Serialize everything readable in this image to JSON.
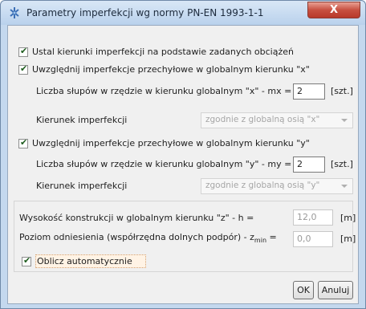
{
  "window": {
    "title": "Parametry imperfekcji wg normy PN-EN 1993-1-1",
    "close_glyph": "X",
    "icon": "app-icon"
  },
  "options": {
    "auto_directions_label": "Ustal kierunki imperfekcji na podstawie zadanych obciążeń",
    "x": {
      "checkbox_label": "Uwzględnij imperfekcje przechyłowe w globalnym kierunku \"x\"",
      "count_label": "Liczba słupów w rzędzie w kierunku globalnym \"x\" - mx =",
      "count_value": "2",
      "count_unit": "[szt.]",
      "direction_label": "Kierunek imperfekcji",
      "direction_value": "zgodnie z globalną osią \"x\""
    },
    "y": {
      "checkbox_label": "Uwzględnij imperfekcje przechyłowe w globalnym kierunku \"y\"",
      "count_label": "Liczba słupów w rzędzie w kierunku globalnym \"y\" - my =",
      "count_value": "2",
      "count_unit": "[szt.]",
      "direction_label": "Kierunek imperfekcji",
      "direction_value": "zgodnie z globalną osią \"y\""
    }
  },
  "structure": {
    "height_label": "Wysokość konstrukcji w globalnym kierunku \"z\" - h =",
    "height_value": "12,0",
    "height_unit": "[m]",
    "ref_label": "Poziom odniesienia (współrzędna dolnych podpór) - z",
    "ref_sub": "min",
    "ref_eq": "=",
    "ref_value": "0,0",
    "ref_unit": "[m]",
    "auto_label": "Oblicz automatycznie"
  },
  "buttons": {
    "ok": "OK",
    "cancel": "Anuluj"
  },
  "checked_glyph": "✔"
}
